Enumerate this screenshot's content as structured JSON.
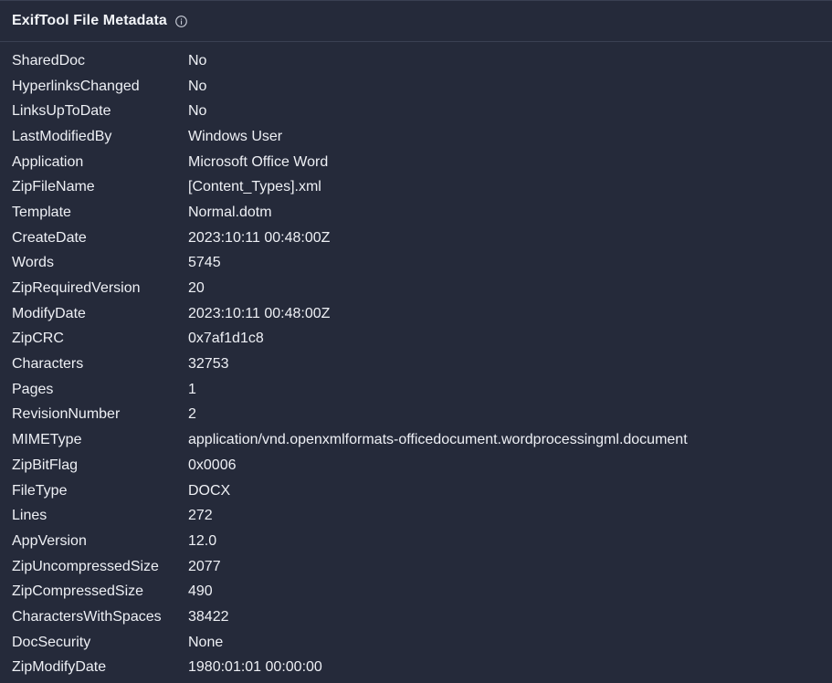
{
  "header": {
    "title": "ExifTool File Metadata",
    "info_icon": "info-icon"
  },
  "metadata": [
    {
      "key": "SharedDoc",
      "value": "No"
    },
    {
      "key": "HyperlinksChanged",
      "value": "No"
    },
    {
      "key": "LinksUpToDate",
      "value": "No"
    },
    {
      "key": "LastModifiedBy",
      "value": "Windows User"
    },
    {
      "key": "Application",
      "value": "Microsoft Office Word"
    },
    {
      "key": "ZipFileName",
      "value": "[Content_Types].xml"
    },
    {
      "key": "Template",
      "value": "Normal.dotm"
    },
    {
      "key": "CreateDate",
      "value": "2023:10:11 00:48:00Z"
    },
    {
      "key": "Words",
      "value": "5745"
    },
    {
      "key": "ZipRequiredVersion",
      "value": "20"
    },
    {
      "key": "ModifyDate",
      "value": "2023:10:11 00:48:00Z"
    },
    {
      "key": "ZipCRC",
      "value": "0x7af1d1c8"
    },
    {
      "key": "Characters",
      "value": "32753"
    },
    {
      "key": "Pages",
      "value": "1"
    },
    {
      "key": "RevisionNumber",
      "value": "2"
    },
    {
      "key": "MIMEType",
      "value": "application/vnd.openxmlformats-officedocument.wordprocessingml.document"
    },
    {
      "key": "ZipBitFlag",
      "value": "0x0006"
    },
    {
      "key": "FileType",
      "value": "DOCX"
    },
    {
      "key": "Lines",
      "value": "272"
    },
    {
      "key": "AppVersion",
      "value": "12.0"
    },
    {
      "key": "ZipUncompressedSize",
      "value": "2077"
    },
    {
      "key": "ZipCompressedSize",
      "value": "490"
    },
    {
      "key": "CharactersWithSpaces",
      "value": "38422"
    },
    {
      "key": "DocSecurity",
      "value": "None"
    },
    {
      "key": "ZipModifyDate",
      "value": "1980:01:01 00:00:00"
    }
  ]
}
